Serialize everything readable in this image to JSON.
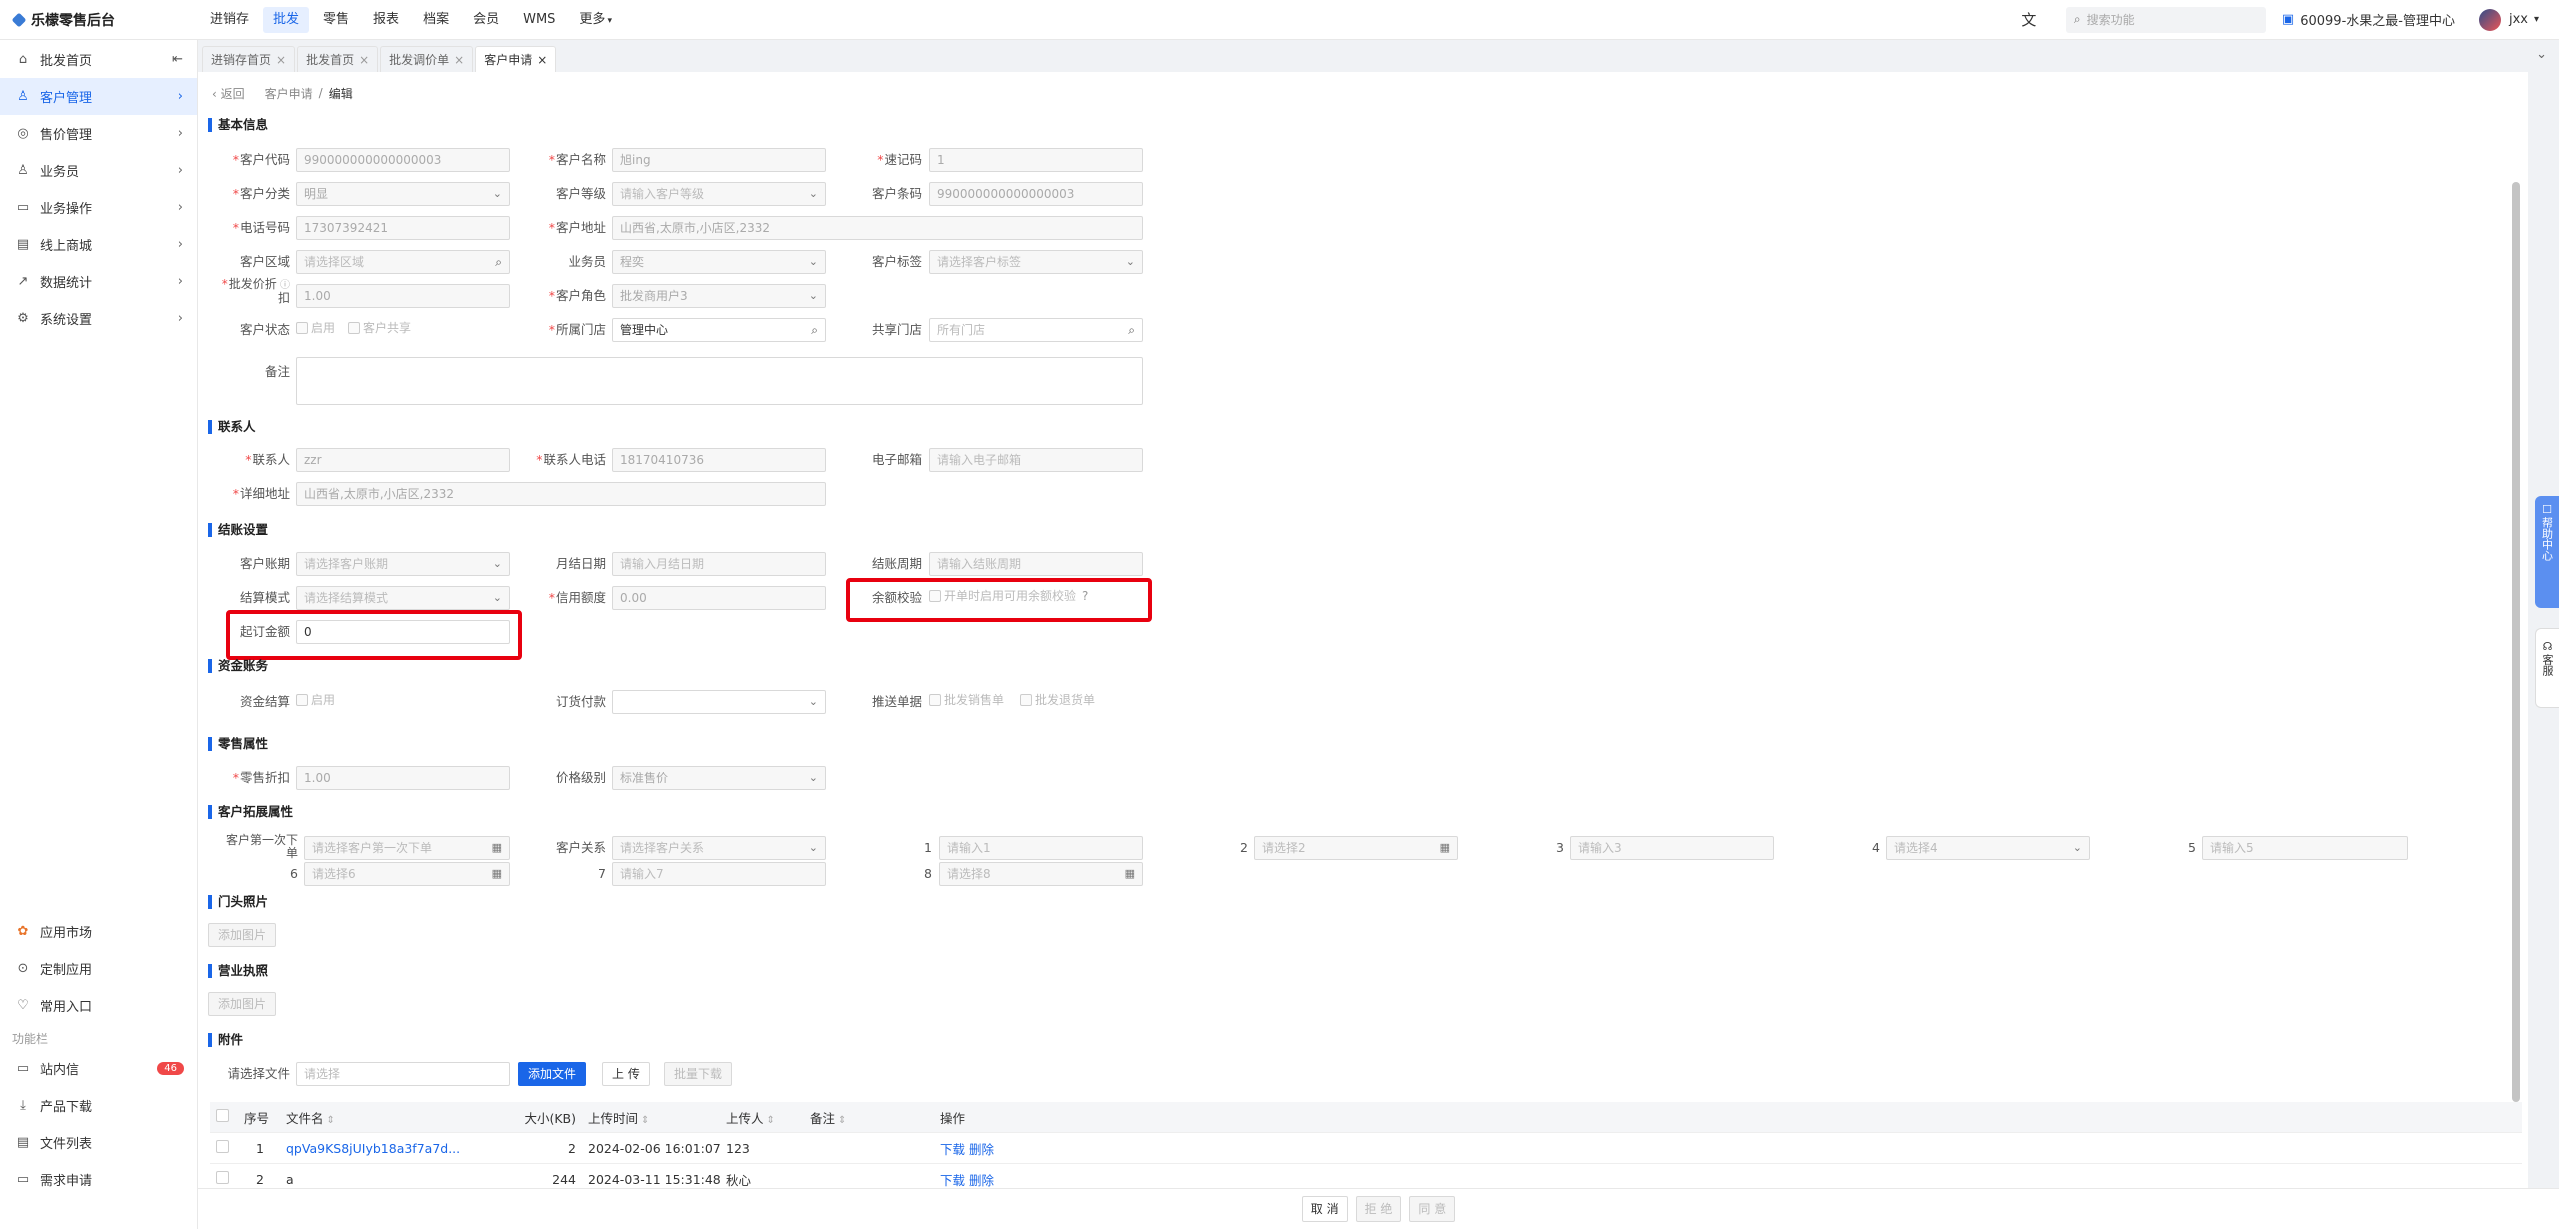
{
  "topbar": {
    "brand": "乐檬零售后台",
    "nav": [
      "进销存",
      "批发",
      "零售",
      "报表",
      "档案",
      "会员",
      "WMS",
      "更多"
    ],
    "search_placeholder": "搜索功能",
    "store": "60099-水果之最-管理中心",
    "user": "jxx"
  },
  "sidebar": {
    "items": [
      {
        "label": "批发首页",
        "icon": "home-icon"
      },
      {
        "label": "客户管理",
        "icon": "user-icon"
      },
      {
        "label": "售价管理",
        "icon": "price-icon"
      },
      {
        "label": "业务员",
        "icon": "person-icon"
      },
      {
        "label": "业务操作",
        "icon": "operation-icon"
      },
      {
        "label": "线上商城",
        "icon": "shop-icon"
      },
      {
        "label": "数据统计",
        "icon": "chart-icon"
      },
      {
        "label": "系统设置",
        "icon": "settings-icon"
      }
    ],
    "bottom_items": [
      {
        "label": "应用市场",
        "icon": "app-market-icon"
      },
      {
        "label": "定制应用",
        "icon": "custom-app-icon"
      },
      {
        "label": "常用入口",
        "icon": "heart-icon"
      }
    ],
    "group_label": "功能栏",
    "func_items": [
      {
        "label": "站内信",
        "icon": "message-icon",
        "badge": "46"
      },
      {
        "label": "产品下载",
        "icon": "download-icon"
      },
      {
        "label": "文件列表",
        "icon": "file-list-icon"
      },
      {
        "label": "需求申请",
        "icon": "request-icon"
      }
    ]
  },
  "tabs": [
    "进销存首页",
    "批发首页",
    "批发调价单",
    "客户申请"
  ],
  "breadcrumb": {
    "back": "返回",
    "parent": "客户申请",
    "current": "编辑"
  },
  "sections": {
    "basic": "基本信息",
    "contact": "联系人",
    "settlement": "结账设置",
    "fund": "资金账务",
    "retail": "零售属性",
    "extend": "客户拓展属性",
    "photo": "门头照片",
    "license": "营业执照",
    "attach": "附件"
  },
  "basic": {
    "code_label": "客户代码",
    "code": "990000000000000003",
    "name_label": "客户名称",
    "name": "旭ing",
    "quick_label": "速记码",
    "quick": "1",
    "category_label": "客户分类",
    "category": "明显",
    "level_label": "客户等级",
    "level_ph": "请输入客户等级",
    "barcode_label": "客户条码",
    "barcode": "990000000000000003",
    "phone_label": "电话号码",
    "phone": "17307392421",
    "address_label": "客户地址",
    "address": "山西省,太原市,小店区,2332",
    "region_label": "客户区域",
    "region_ph": "请选择区域",
    "salesman_label": "业务员",
    "salesman": "程奕",
    "tag_label": "客户标签",
    "tag_ph": "请选择客户标签",
    "discount_label_1": "批发价折",
    "discount_label_2": "扣",
    "discount": "1.00",
    "role_label": "客户角色",
    "role": "批发商用户3",
    "status_label": "客户状态",
    "status_enabled": "启用",
    "status_shared": "客户共享",
    "store_label": "所属门店",
    "store": "管理中心",
    "shared_store_label": "共享门店",
    "shared_store_ph": "所有门店",
    "remark_label": "备注"
  },
  "contact": {
    "person_label": "联系人",
    "person": "zzr",
    "phone_label": "联系人电话",
    "phone": "18170410736",
    "email_label": "电子邮箱",
    "email_ph": "请输入电子邮箱",
    "detail_label": "详细地址",
    "detail": "山西省,太原市,小店区,2332"
  },
  "settlement": {
    "period_label": "客户账期",
    "period_ph": "请选择客户账期",
    "month_label": "月结日期",
    "month_ph": "请输入月结日期",
    "cycle_label": "结账周期",
    "cycle_ph": "请输入结账周期",
    "mode_label": "结算模式",
    "mode_ph": "请选择结算模式",
    "credit_label": "信用额度",
    "credit": "0.00",
    "balance_label": "余额校验",
    "balance_text": "开单时启用可用余额校验",
    "min_label": "起订金额",
    "min": "0"
  },
  "fund": {
    "fund_label": "资金结算",
    "fund_enabled": "启用",
    "pay_label": "订货付款",
    "push_label": "推送单据",
    "push_sale": "批发销售单",
    "push_return": "批发退货单"
  },
  "retail": {
    "discount_label": "零售折扣",
    "discount": "1.00",
    "price_label": "价格级别",
    "price": "标准售价"
  },
  "extend": {
    "first_label_1": "客户第一次下",
    "first_label_2": "单",
    "first_ph": "请选择客户第一次下单",
    "relation_label": "客户关系",
    "relation_ph": "请选择客户关系",
    "f1_label": "1",
    "f1_ph": "请输入1",
    "f2_label": "2",
    "f2_ph": "请选择2",
    "f3_label": "3",
    "f3_ph": "请输入3",
    "f4_label": "4",
    "f4_ph": "请选择4",
    "f5_label": "5",
    "f5_ph": "请输入5",
    "f6_label": "6",
    "f6_ph": "请选择6",
    "f7_label": "7",
    "f7_ph": "请输入7",
    "f8_label": "8",
    "f8_ph": "请选择8"
  },
  "photo_btn": "添加图片",
  "license_btn": "添加图片",
  "attach": {
    "file_label": "请选择文件",
    "file_ph": "请选择",
    "add_btn": "添加文件",
    "upload_btn": "上 传",
    "batch_btn": "批量下载"
  },
  "table": {
    "headers": [
      "序号",
      "文件名",
      "大小(KB)",
      "上传时间",
      "上传人",
      "备注",
      "操作"
    ],
    "rows": [
      {
        "no": "1",
        "name": "qpVa9KS8jUIyb18a3f7a7d...",
        "size": "2",
        "time": "2024-02-06 16:01:07",
        "user": "123",
        "remark": "",
        "download": "下载",
        "delete": "删除"
      },
      {
        "no": "2",
        "name": "a",
        "size": "244",
        "time": "2024-03-11 15:31:48",
        "user": "秋心",
        "remark": "",
        "download": "下载",
        "delete": "删除"
      }
    ]
  },
  "footer": {
    "cancel": "取 消",
    "reject": "拒 绝",
    "approve": "同 意"
  },
  "help_center": "帮助中心",
  "kefu": "客服"
}
